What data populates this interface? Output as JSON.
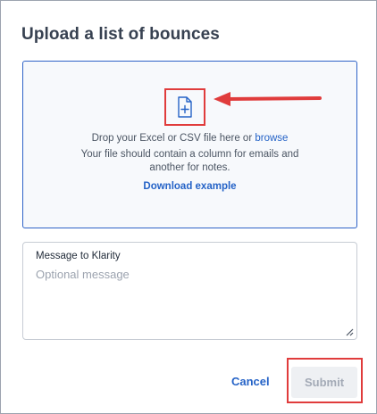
{
  "dialog": {
    "title": "Upload a list of bounces"
  },
  "dropzone": {
    "prompt_text": "Drop your Excel or CSV file here or ",
    "browse_link": "browse",
    "help_line_1": "Your file should contain a column for emails and",
    "help_line_2": "another for notes.",
    "download_link": "Download example",
    "icon": "file-plus-icon",
    "annotation_color": "#e03c3c"
  },
  "message": {
    "label": "Message to Klarity",
    "placeholder": "Optional message",
    "value": ""
  },
  "footer": {
    "cancel_label": "Cancel",
    "submit_label": "Submit"
  },
  "colors": {
    "accent": "#2563c7",
    "dropzone_border": "#2f63c7",
    "annotation": "#e03c3c",
    "submit_disabled_bg": "#eef0f3"
  }
}
